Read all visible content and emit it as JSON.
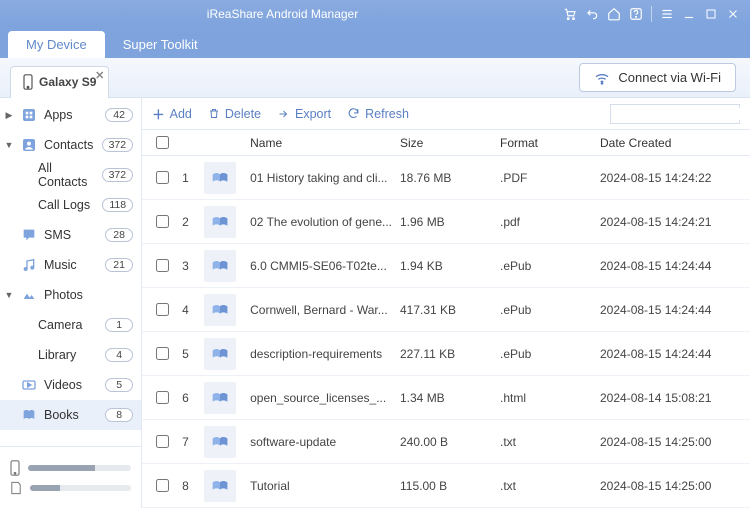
{
  "app": {
    "title": "iReaShare Android Manager"
  },
  "tabs": {
    "my_device": "My Device",
    "super_toolkit": "Super Toolkit"
  },
  "device": {
    "name": "Galaxy S9"
  },
  "wifi_btn": "Connect via Wi-Fi",
  "sidebar": {
    "items": [
      {
        "label": "Apps",
        "badge": "42",
        "icon": "apps",
        "arrow": "▶"
      },
      {
        "label": "Contacts",
        "badge": "372",
        "icon": "contacts",
        "arrow": "▼"
      },
      {
        "label": "All Contacts",
        "badge": "372",
        "child": true
      },
      {
        "label": "Call Logs",
        "badge": "118",
        "child": true
      },
      {
        "label": "SMS",
        "badge": "28",
        "icon": "sms",
        "arrow": ""
      },
      {
        "label": "Music",
        "badge": "21",
        "icon": "music",
        "arrow": ""
      },
      {
        "label": "Photos",
        "badge": "",
        "icon": "photos",
        "arrow": "▼"
      },
      {
        "label": "Camera",
        "badge": "1",
        "child": true
      },
      {
        "label": "Library",
        "badge": "4",
        "child": true
      },
      {
        "label": "Videos",
        "badge": "5",
        "icon": "videos",
        "arrow": ""
      },
      {
        "label": "Books",
        "badge": "8",
        "icon": "books",
        "arrow": "",
        "active": true
      }
    ]
  },
  "storage": [
    {
      "icon": "phone",
      "pct": 65
    },
    {
      "icon": "sd",
      "pct": 30
    }
  ],
  "toolbar": {
    "add": "Add",
    "delete": "Delete",
    "export": "Export",
    "refresh": "Refresh"
  },
  "columns": {
    "name": "Name",
    "size": "Size",
    "format": "Format",
    "date": "Date Created"
  },
  "rows": [
    {
      "idx": "1",
      "name": "01 History taking and cli...",
      "size": "18.76 MB",
      "fmt": ".PDF",
      "date": "2024-08-15 14:24:22"
    },
    {
      "idx": "2",
      "name": "02 The evolution of gene...",
      "size": "1.96 MB",
      "fmt": ".pdf",
      "date": "2024-08-15 14:24:21"
    },
    {
      "idx": "3",
      "name": "6.0 CMMI5-SE06-T02te...",
      "size": "1.94 KB",
      "fmt": ".ePub",
      "date": "2024-08-15 14:24:44"
    },
    {
      "idx": "4",
      "name": "Cornwell, Bernard - War...",
      "size": "417.31 KB",
      "fmt": ".ePub",
      "date": "2024-08-15 14:24:44"
    },
    {
      "idx": "5",
      "name": "description-requirements",
      "size": "227.11 KB",
      "fmt": ".ePub",
      "date": "2024-08-15 14:24:44"
    },
    {
      "idx": "6",
      "name": "open_source_licenses_...",
      "size": "1.34 MB",
      "fmt": ".html",
      "date": "2024-08-14 15:08:21"
    },
    {
      "idx": "7",
      "name": "software-update",
      "size": "240.00 B",
      "fmt": ".txt",
      "date": "2024-08-15 14:25:00"
    },
    {
      "idx": "8",
      "name": "Tutorial",
      "size": "115.00 B",
      "fmt": ".txt",
      "date": "2024-08-15 14:25:00"
    }
  ]
}
